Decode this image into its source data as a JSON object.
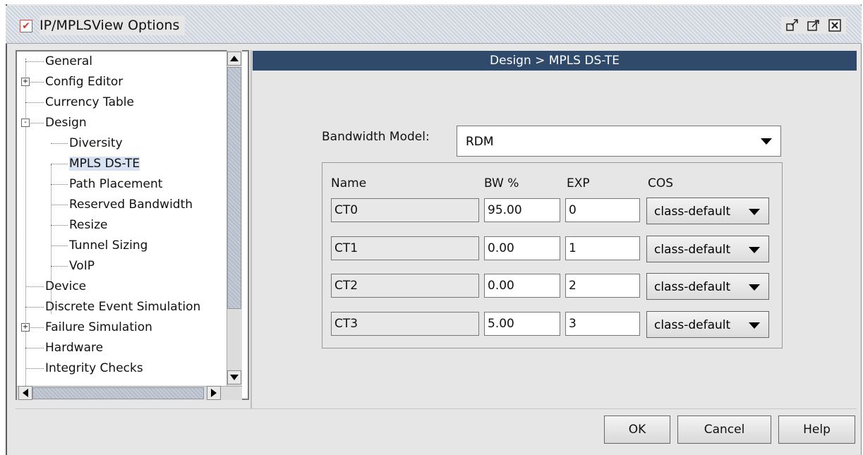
{
  "window": {
    "title": "IP/MPLSView Options",
    "icons": [
      "checkmark-app-icon",
      "restore-icon",
      "maximize-icon",
      "close-icon"
    ]
  },
  "tree": {
    "items": [
      {
        "label": "General",
        "expander": ""
      },
      {
        "label": "Config Editor",
        "expander": "+"
      },
      {
        "label": "Currency Table",
        "expander": ""
      },
      {
        "label": "Design",
        "expander": "-"
      },
      {
        "label": "Diversity",
        "expander": ""
      },
      {
        "label": "MPLS DS-TE",
        "expander": "",
        "selected": true
      },
      {
        "label": "Path Placement",
        "expander": ""
      },
      {
        "label": "Reserved Bandwidth",
        "expander": ""
      },
      {
        "label": "Resize",
        "expander": ""
      },
      {
        "label": "Tunnel Sizing",
        "expander": ""
      },
      {
        "label": "VoIP",
        "expander": ""
      },
      {
        "label": "Device",
        "expander": ""
      },
      {
        "label": "Discrete Event Simulation",
        "expander": ""
      },
      {
        "label": "Failure Simulation",
        "expander": "+"
      },
      {
        "label": "Hardware",
        "expander": ""
      },
      {
        "label": "Integrity Checks",
        "expander": ""
      }
    ]
  },
  "panel": {
    "header": "Design > MPLS DS-TE",
    "bandwidth_model_label": "Bandwidth Model:",
    "bandwidth_model_value": "RDM"
  },
  "table": {
    "headers": {
      "name": "Name",
      "bw": "BW %",
      "exp": "EXP",
      "cos": "COS"
    },
    "rows": [
      {
        "name": "CT0",
        "bw": "95.00",
        "exp": "0",
        "cos": "class-default"
      },
      {
        "name": "CT1",
        "bw": "0.00",
        "exp": "1",
        "cos": "class-default"
      },
      {
        "name": "CT2",
        "bw": "0.00",
        "exp": "2",
        "cos": "class-default"
      },
      {
        "name": "CT3",
        "bw": "5.00",
        "exp": "3",
        "cos": "class-default"
      }
    ]
  },
  "buttons": {
    "ok": "OK",
    "cancel": "Cancel",
    "help": "Help"
  },
  "colors": {
    "header_bg": "#2f4a6b",
    "selection": "#d7e3f2"
  }
}
